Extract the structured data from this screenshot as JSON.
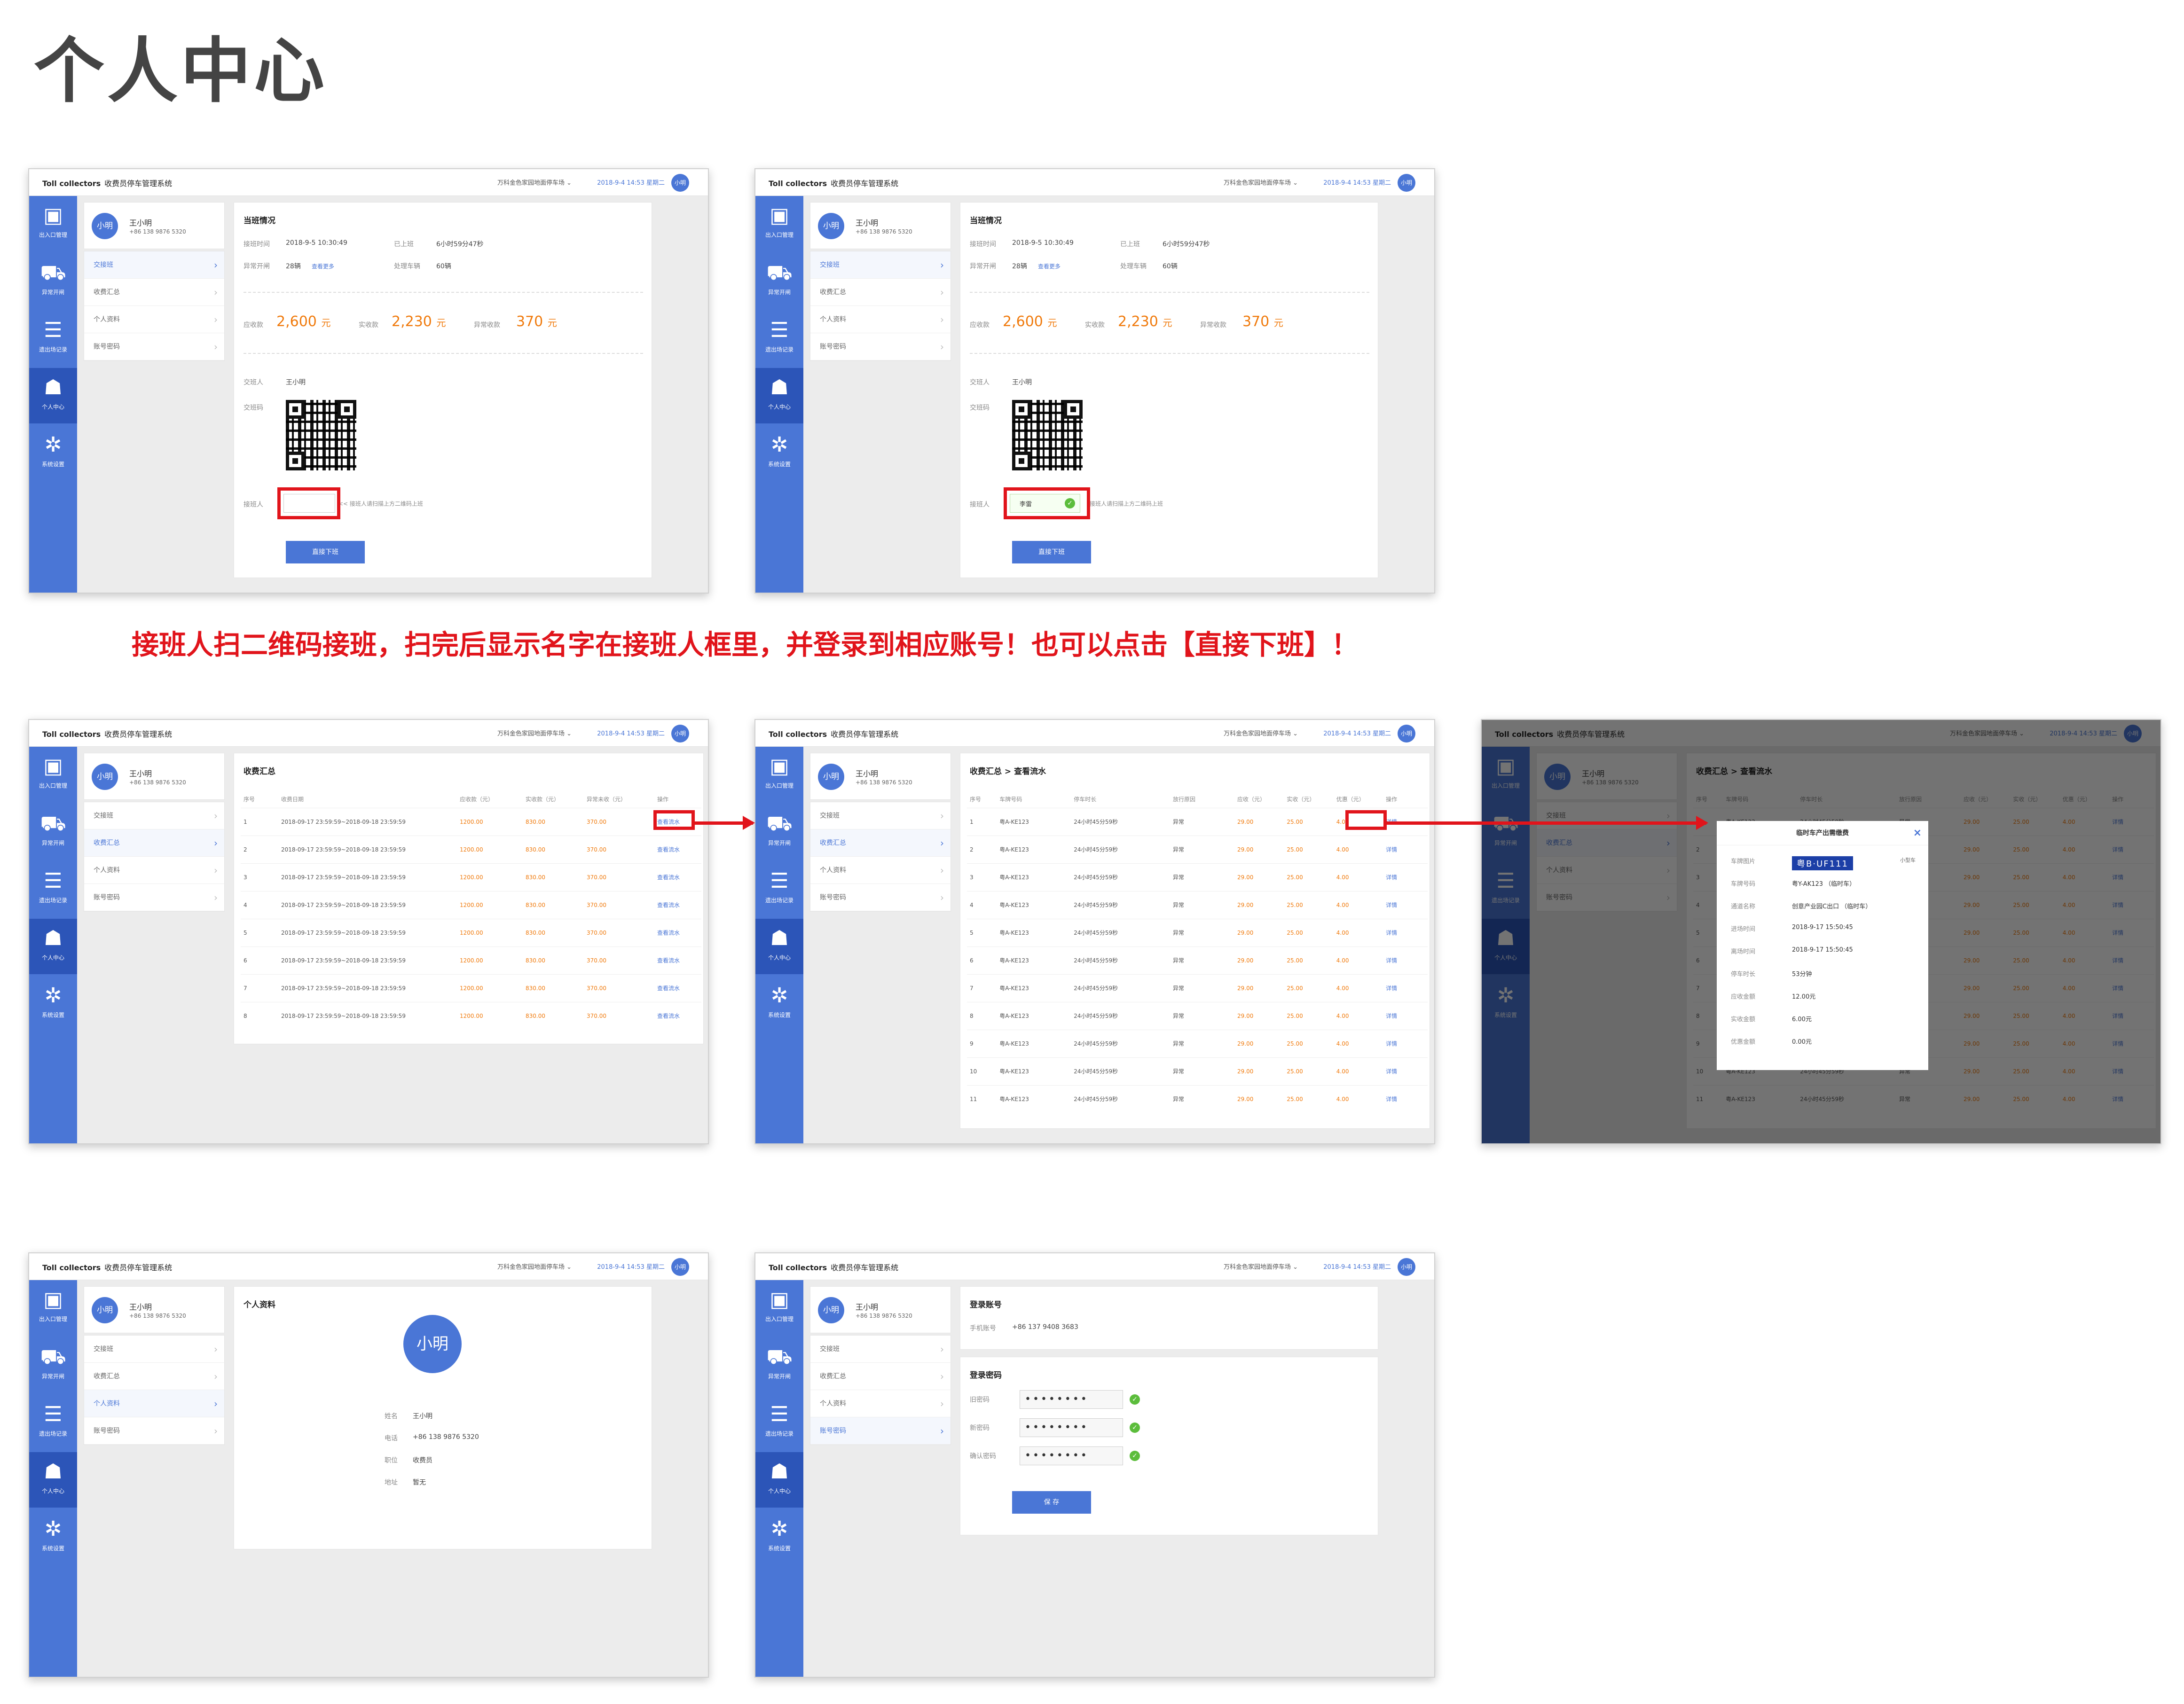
{
  "page_title": "个人中心",
  "caption": "接班人扫二维码接班，扫完后显示名字在接班人框里，并登录到相应账号！也可以点击【直接下班】！",
  "app": {
    "brand": "Toll collectors",
    "system": "收费员停车管理系统",
    "location": "万科金色家园地面停车场",
    "datetime": "2018-9-4 14:53 星期二",
    "avatar": "小明"
  },
  "nav": [
    {
      "label": "出入口管理",
      "icon": "gate-icon"
    },
    {
      "label": "异常开闸",
      "icon": "car-icon"
    },
    {
      "label": "遗出场记录",
      "icon": "list-icon"
    },
    {
      "label": "个人中心",
      "icon": "user-icon"
    },
    {
      "label": "系统设置",
      "icon": "gear-icon"
    }
  ],
  "profile": {
    "name": "王小明",
    "phone": "+86 138 9876 5320",
    "avatar": "小明"
  },
  "menu": [
    "交接班",
    "收费汇总",
    "个人资料",
    "账号密码"
  ],
  "shift": {
    "title": "当班情况",
    "start_label": "接班时间",
    "start": "2018-9-5 10:30:49",
    "worked_label": "已上班",
    "worked": "6小时59分47秒",
    "abn_label": "异常开闸",
    "abn": "28辆",
    "more": "查看更多",
    "handled_label": "处理车辆",
    "handled": "60辆",
    "due_label": "应收款",
    "due": "2,600",
    "paid_label": "实收款",
    "paid": "2,230",
    "unpaid_label": "异常收款",
    "unpaid": "370",
    "unit": "元",
    "handover_label": "交班人",
    "handover": "王小明",
    "code_label": "交班码",
    "receiver_label": "接班人",
    "receiver_hint": "<< 接班人请扫描上方二维码上班",
    "receiver_filled": "李雷",
    "receiver_hint2": "接班人请扫描上方二维码上班",
    "offduty": "直接下班"
  },
  "summary": {
    "title": "收费汇总",
    "headers": [
      "序号",
      "收费日期",
      "应收款（元）",
      "实收款（元）",
      "异常未收（元）",
      "操作"
    ],
    "date": "2018-09-17 23:59:59~2018-09-18 23:59:59",
    "due": "1200.00",
    "paid": "830.00",
    "unpaid": "370.00",
    "action": "查看流水"
  },
  "flow": {
    "title": "收费汇总 > 查看流水",
    "headers": [
      "序号",
      "车牌号码",
      "停车时长",
      "放行原因",
      "应收（元）",
      "实收（元）",
      "优惠（元）",
      "操作"
    ],
    "plate": "粤A-KE123",
    "dur": "24小时45分59秒",
    "reason": "异常",
    "due": "29.00",
    "paid": "25.00",
    "disc": "4.00",
    "action": "详情"
  },
  "modal": {
    "title": "临时车产出需缴费",
    "photo_label": "车牌图片",
    "photo": "粤B·UF111",
    "type": "小型车",
    "plate_label": "车牌号码",
    "plate": "粤Y-AK123 （临时车）",
    "channel_label": "通道名称",
    "channel": "创意产业园C出口 （临时车）",
    "in_label": "进场时间",
    "in": "2018-9-17 15:50:45",
    "out_label": "离场时间",
    "out": "2018-9-17 15:50:45",
    "dur_label": "停车时长",
    "dur": "53分钟",
    "due_label": "应收金额",
    "due": "12.00元",
    "paid_label": "实收金额",
    "paid": "6.00元",
    "disc_label": "优惠金额",
    "disc": "0.00元"
  },
  "personal": {
    "title": "个人资料",
    "avatar": "小明",
    "name_label": "姓名",
    "name": "王小明",
    "phone_label": "电话",
    "phone": "+86 138 9876 5320",
    "post_label": "职位",
    "post": "收费员",
    "addr_label": "地址",
    "addr": "暂无"
  },
  "account": {
    "title": "登录账号",
    "phone_label": "手机账号",
    "phone": "+86 137 9408 3683",
    "pwd_title": "登录密码",
    "old_label": "旧密码",
    "new_label": "新密码",
    "confirm_label": "确认密码",
    "dots": "••••••••",
    "save": "保 存"
  }
}
